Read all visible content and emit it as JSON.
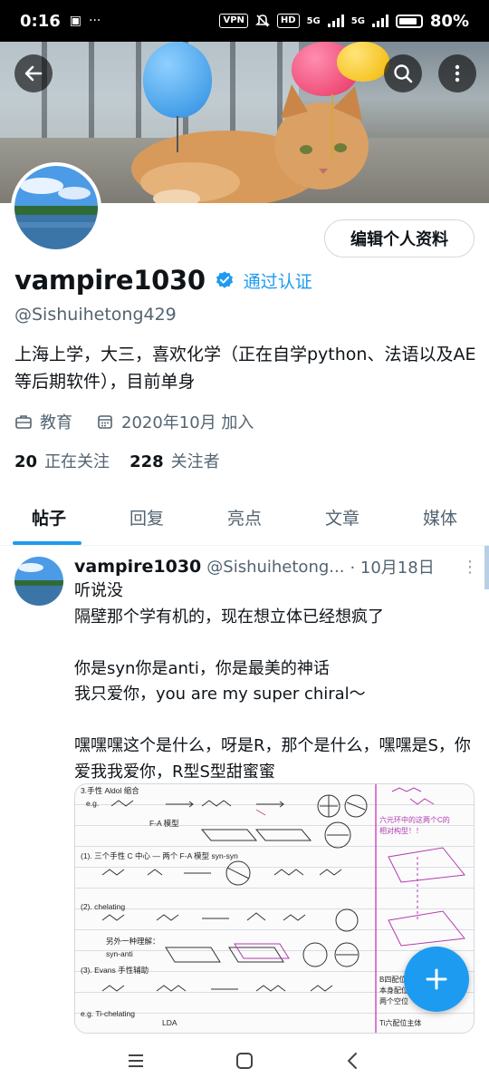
{
  "status_bar": {
    "time": "0:16",
    "vpn": "VPN",
    "hd": "HD",
    "net1": "5G",
    "net2": "5G",
    "battery": "80%"
  },
  "profile": {
    "edit_button": "编辑个人资料",
    "display_name": "vampire1030",
    "verified_label": "通过认证",
    "handle": "@Sishuihetong429",
    "bio": "上海上学，大三，喜欢化学（正在自学python、法语以及AE等后期软件），目前单身",
    "category": "教育",
    "joined": "2020年10月 加入",
    "following_count": "20",
    "following_label": "正在关注",
    "followers_count": "228",
    "followers_label": "关注者"
  },
  "tabs": [
    {
      "label": "帖子",
      "active": true
    },
    {
      "label": "回复",
      "active": false
    },
    {
      "label": "亮点",
      "active": false
    },
    {
      "label": "文章",
      "active": false
    },
    {
      "label": "媒体",
      "active": false
    }
  ],
  "post": {
    "name": "vampire1030",
    "handle": "@Sishuihetong...",
    "date": "· 10月18日",
    "text": "听说没\n隔壁那个学有机的，现在想立体已经想疯了\n\n你是syn你是anti，你是最美的神话\n我只爱你，you are my super chiral～\n\n嘿嘿嘿这个是什么，呀是R，那个是什么，嘿嘿是S，你爱我我爱你，R型S型甜蜜蜜"
  },
  "notes_image": {
    "lines": [
      "3.手性 Aldol 缩合",
      "e.g.",
      "F-A 模型",
      "(1). 三个手性 C 中心 — 两个 F-A 模型  syn-syn",
      "(2). chelating",
      "另外一种理解：",
      "syn-anti",
      "(3). Evans 手性辅助",
      "e.g. Ti-chelating",
      "LDA"
    ],
    "side_notes": [
      "六元环中的这两个C的",
      "相对构型！！",
      "B四配位主体",
      "本身配位只有",
      "两个空位",
      "Ti六配位主体"
    ]
  },
  "colors": {
    "accent": "#1d9bf0",
    "text": "#0f1419",
    "secondary": "#536471"
  }
}
